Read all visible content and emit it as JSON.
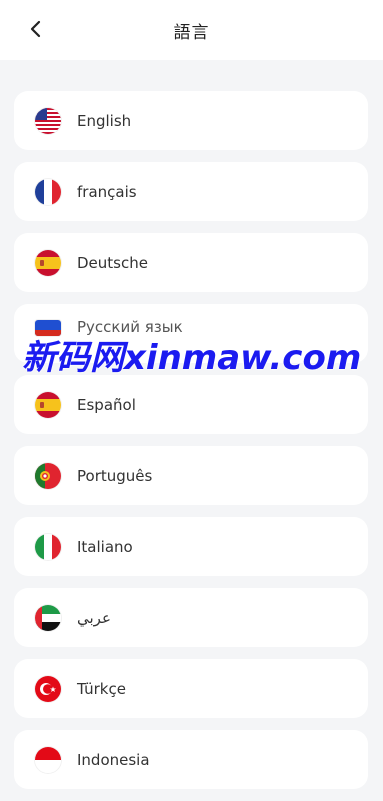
{
  "header": {
    "title": "語言",
    "back_icon": "chevron-left-icon"
  },
  "languages": [
    {
      "label": "English",
      "flag": "us-flag-icon"
    },
    {
      "label": "français",
      "flag": "france-flag-icon"
    },
    {
      "label": "Deutsche",
      "flag": "spain-flag-icon"
    },
    {
      "label": "Русский язык",
      "flag": "russia-flag-icon"
    },
    {
      "label": "Español",
      "flag": "spain-flag-icon"
    },
    {
      "label": "Português",
      "flag": "portugal-flag-icon"
    },
    {
      "label": "Italiano",
      "flag": "italy-flag-icon"
    },
    {
      "label": "عربي",
      "flag": "uae-flag-icon"
    },
    {
      "label": "Türkçe",
      "flag": "turkey-flag-icon"
    },
    {
      "label": "Indonesia",
      "flag": "indonesia-flag-icon"
    }
  ],
  "watermark": "新码网xinmaw.com",
  "colors": {
    "accent": "#1b1bf0",
    "background": "#f4f5f7"
  }
}
